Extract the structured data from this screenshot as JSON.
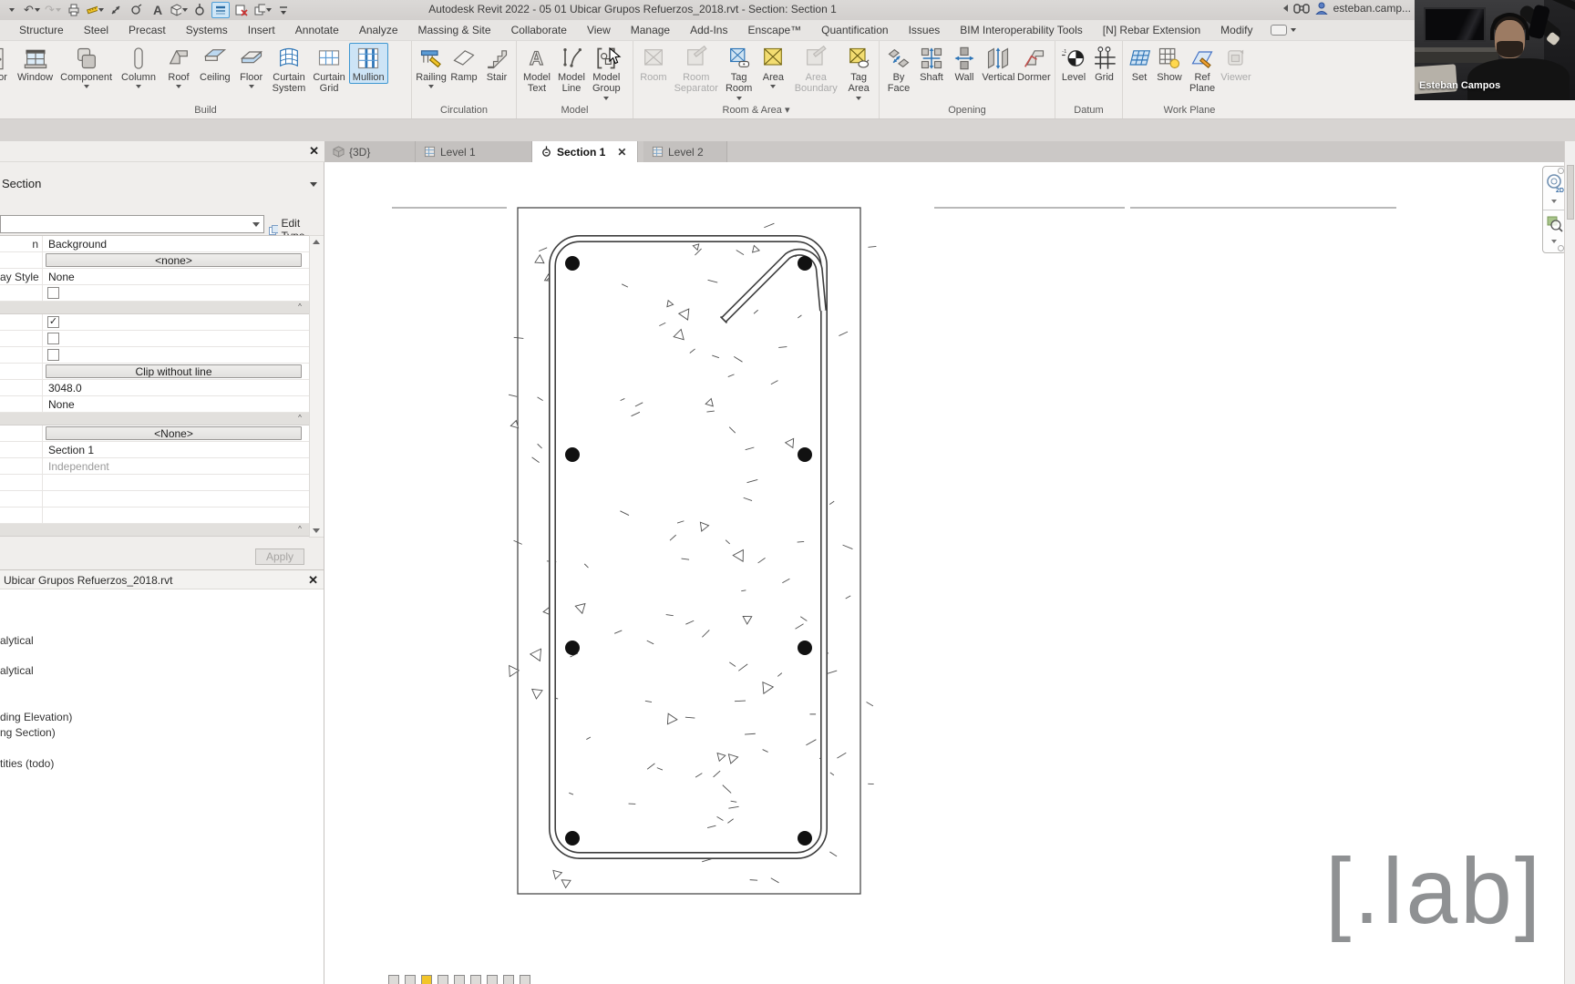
{
  "window": {
    "title": "Autodesk Revit 2022 - 05 01 Ubicar Grupos Refuerzos_2018.rvt - Section: Section 1",
    "user": "esteban.camp..."
  },
  "quick_access": {
    "icons": [
      "menu-chevron",
      "undo",
      "redo",
      "print",
      "measure",
      "scale",
      "tag",
      "text",
      "default-3d-view",
      "section",
      "thin-lines",
      "close-hidden-windows",
      "switch-windows",
      "customize"
    ],
    "undo_glyph": "↶",
    "redo_glyph": "↷",
    "text_glyph": "A"
  },
  "ribbon": {
    "tabs": [
      "Structure",
      "Steel",
      "Precast",
      "Systems",
      "Insert",
      "Annotate",
      "Analyze",
      "Massing & Site",
      "Collaborate",
      "View",
      "Manage",
      "Add-Ins",
      "Enscape™",
      "Quantification",
      "Issues",
      "BIM Interoperability Tools",
      "[N] Rebar Extension",
      "Modify"
    ],
    "panels": [
      {
        "label": "Build",
        "buttons": [
          {
            "label": "Door"
          },
          {
            "label": "Window"
          },
          {
            "label": "Component",
            "arrow": true
          },
          {
            "label": "Column",
            "arrow": true
          },
          {
            "label": "Roof",
            "arrow": true
          },
          {
            "label": "Ceiling"
          },
          {
            "label": "Floor",
            "arrow": true
          },
          {
            "label": "Curtain\nSystem"
          },
          {
            "label": "Curtain\nGrid"
          },
          {
            "label": "Mullion",
            "selected": true
          }
        ]
      },
      {
        "label": "Circulation",
        "buttons": [
          {
            "label": "Railing",
            "arrow": true
          },
          {
            "label": "Ramp"
          },
          {
            "label": "Stair"
          }
        ]
      },
      {
        "label": "Model",
        "buttons": [
          {
            "label": "Model\nText"
          },
          {
            "label": "Model\nLine"
          },
          {
            "label": "Model\nGroup",
            "arrow": true
          }
        ]
      },
      {
        "label": "Room & Area ▾",
        "buttons": [
          {
            "label": "Room",
            "disabled": true
          },
          {
            "label": "Room\nSeparator",
            "disabled": true
          },
          {
            "label": "Tag\nRoom",
            "arrow": true
          },
          {
            "label": "Area",
            "arrow": true
          },
          {
            "label": "Area\nBoundary",
            "disabled": true
          },
          {
            "label": "Tag\nArea",
            "arrow": true
          }
        ]
      },
      {
        "label": "Opening",
        "buttons": [
          {
            "label": "By\nFace"
          },
          {
            "label": "Shaft"
          },
          {
            "label": "Wall"
          },
          {
            "label": "Vertical"
          },
          {
            "label": "Dormer"
          }
        ]
      },
      {
        "label": "Datum",
        "buttons": [
          {
            "label": "Level"
          },
          {
            "label": "Grid"
          }
        ]
      },
      {
        "label": "Work Plane",
        "buttons": [
          {
            "label": "Set"
          },
          {
            "label": "Show"
          },
          {
            "label": "Ref\nPlane"
          },
          {
            "label": "Viewer",
            "disabled": true
          }
        ]
      }
    ]
  },
  "view_tabs": {
    "tabs": [
      {
        "label": "{3D}",
        "active": false
      },
      {
        "label": "Level 1",
        "active": false
      },
      {
        "label": "Section 1",
        "active": true,
        "closable": true
      },
      {
        "label": "Level 2",
        "active": false
      }
    ],
    "close_glyph": "✕"
  },
  "properties": {
    "type_label": "Section",
    "edit_type_label": "Edit Type",
    "apply_label": "Apply",
    "rows": [
      {
        "label": "n",
        "value": "Background"
      },
      {
        "label": "",
        "value": "<none>",
        "kind": "button"
      },
      {
        "label": "ay Style",
        "value": "None"
      },
      {
        "label": "",
        "kind": "check",
        "checked": false
      },
      {
        "kind": "sep"
      },
      {
        "kind": "check",
        "checked": true
      },
      {
        "kind": "check",
        "checked": false
      },
      {
        "kind": "check",
        "checked": false
      },
      {
        "value": "Clip without line",
        "kind": "button"
      },
      {
        "value": "3048.0"
      },
      {
        "value": "None"
      },
      {
        "kind": "sep"
      },
      {
        "value": "<None>",
        "kind": "button"
      },
      {
        "value": "Section 1"
      },
      {
        "value": "Independent",
        "muted": true
      }
    ]
  },
  "project_browser": {
    "title": "Ubicar Grupos Refuerzos_2018.rvt",
    "items": [
      "alytical",
      "alytical",
      "ding Elevation)",
      "ng Section)",
      "tities (todo)"
    ],
    "close_glyph": "✕"
  },
  "canvas": {
    "watermark": "[.lab]",
    "nav_icons": [
      "steering-wheel-2d",
      "zoom-region"
    ],
    "view_control_icons": 9
  },
  "webcam": {
    "name": "Esteban Campos"
  },
  "colors": {
    "selection_blue": "#3e97d1",
    "selection_fill": "#cde4f6",
    "area_yellow": "#f3dd71",
    "ribbon_bg": "#f0eeec",
    "canvas_bg": "#ffffff",
    "watermark_gray": "#8f9193"
  }
}
